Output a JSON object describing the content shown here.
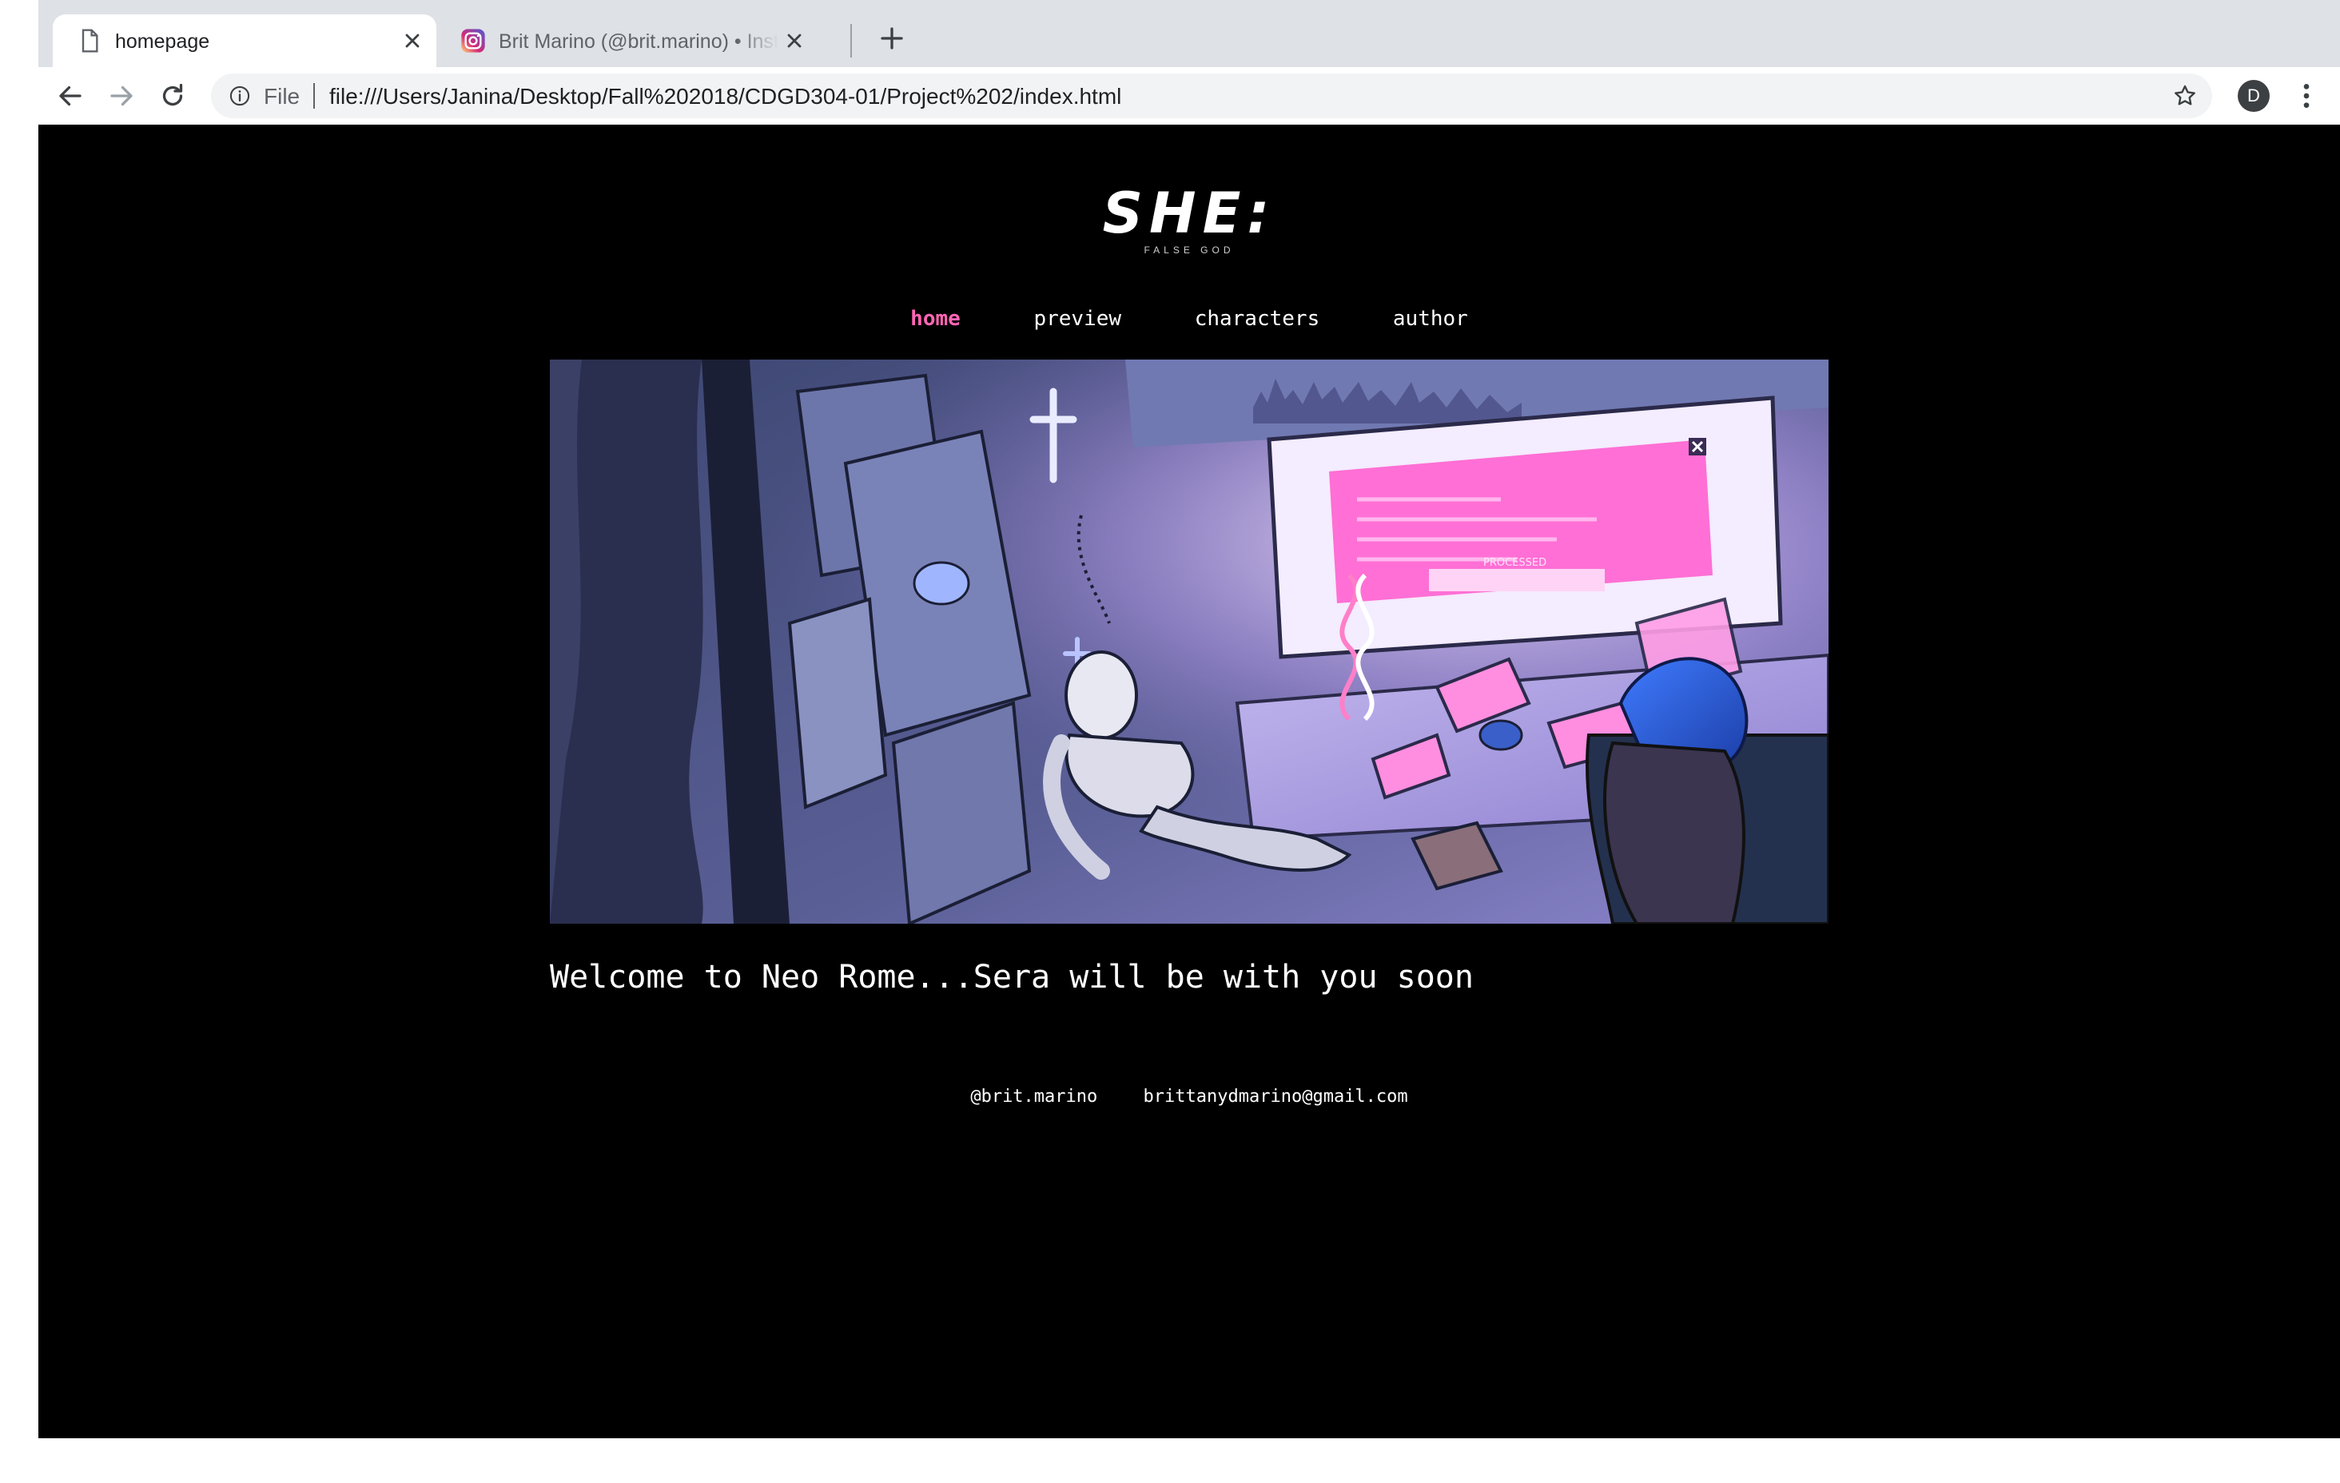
{
  "browser": {
    "tabs": [
      {
        "title": "homepage",
        "active": true,
        "icon": "document-icon"
      },
      {
        "title": "Brit Marino (@brit.marino) • Instagram",
        "active": false,
        "icon": "instagram-icon"
      }
    ],
    "address": {
      "scheme_label": "File",
      "url": "file:///Users/Janina/Desktop/Fall%202018/CDGD304-01/Project%202/index.html"
    },
    "profile_initial": "D"
  },
  "site": {
    "logo": "SHE:",
    "tagline": "FALSE GOD",
    "nav": [
      {
        "label": "home",
        "current": true
      },
      {
        "label": "preview",
        "current": false
      },
      {
        "label": "characters",
        "current": false
      },
      {
        "label": "author",
        "current": false
      }
    ],
    "hero_screen_text": "PROCESSED",
    "welcome": "Welcome to Neo Rome...Sera will be with you soon",
    "footer": {
      "instagram": "@brit.marino",
      "email": "brittanydmarino@gmail.com"
    }
  },
  "colors": {
    "page_bg": "#000000",
    "accent_pink": "#ff66b5",
    "tabstrip": "#dee1e6",
    "omnibox": "#f1f3f4"
  }
}
